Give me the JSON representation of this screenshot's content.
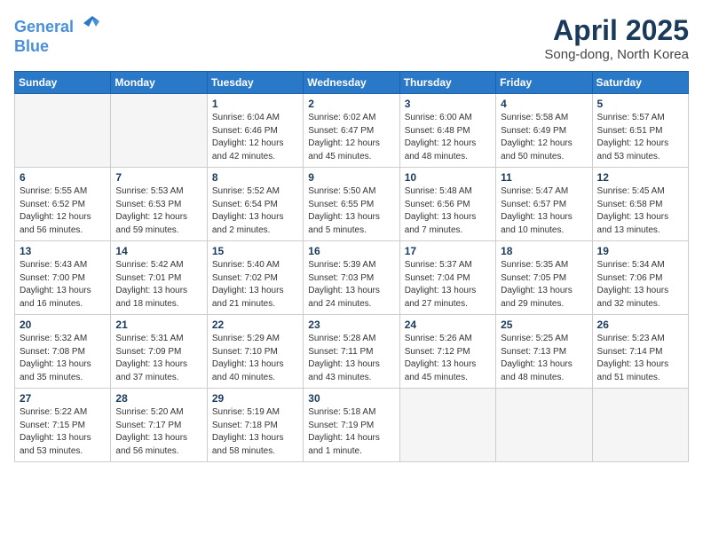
{
  "header": {
    "logo_line1": "General",
    "logo_line2": "Blue",
    "month": "April 2025",
    "location": "Song-dong, North Korea"
  },
  "weekdays": [
    "Sunday",
    "Monday",
    "Tuesday",
    "Wednesday",
    "Thursday",
    "Friday",
    "Saturday"
  ],
  "weeks": [
    [
      {
        "day": "",
        "content": ""
      },
      {
        "day": "",
        "content": ""
      },
      {
        "day": "1",
        "content": "Sunrise: 6:04 AM\nSunset: 6:46 PM\nDaylight: 12 hours and 42 minutes."
      },
      {
        "day": "2",
        "content": "Sunrise: 6:02 AM\nSunset: 6:47 PM\nDaylight: 12 hours and 45 minutes."
      },
      {
        "day": "3",
        "content": "Sunrise: 6:00 AM\nSunset: 6:48 PM\nDaylight: 12 hours and 48 minutes."
      },
      {
        "day": "4",
        "content": "Sunrise: 5:58 AM\nSunset: 6:49 PM\nDaylight: 12 hours and 50 minutes."
      },
      {
        "day": "5",
        "content": "Sunrise: 5:57 AM\nSunset: 6:51 PM\nDaylight: 12 hours and 53 minutes."
      }
    ],
    [
      {
        "day": "6",
        "content": "Sunrise: 5:55 AM\nSunset: 6:52 PM\nDaylight: 12 hours and 56 minutes."
      },
      {
        "day": "7",
        "content": "Sunrise: 5:53 AM\nSunset: 6:53 PM\nDaylight: 12 hours and 59 minutes."
      },
      {
        "day": "8",
        "content": "Sunrise: 5:52 AM\nSunset: 6:54 PM\nDaylight: 13 hours and 2 minutes."
      },
      {
        "day": "9",
        "content": "Sunrise: 5:50 AM\nSunset: 6:55 PM\nDaylight: 13 hours and 5 minutes."
      },
      {
        "day": "10",
        "content": "Sunrise: 5:48 AM\nSunset: 6:56 PM\nDaylight: 13 hours and 7 minutes."
      },
      {
        "day": "11",
        "content": "Sunrise: 5:47 AM\nSunset: 6:57 PM\nDaylight: 13 hours and 10 minutes."
      },
      {
        "day": "12",
        "content": "Sunrise: 5:45 AM\nSunset: 6:58 PM\nDaylight: 13 hours and 13 minutes."
      }
    ],
    [
      {
        "day": "13",
        "content": "Sunrise: 5:43 AM\nSunset: 7:00 PM\nDaylight: 13 hours and 16 minutes."
      },
      {
        "day": "14",
        "content": "Sunrise: 5:42 AM\nSunset: 7:01 PM\nDaylight: 13 hours and 18 minutes."
      },
      {
        "day": "15",
        "content": "Sunrise: 5:40 AM\nSunset: 7:02 PM\nDaylight: 13 hours and 21 minutes."
      },
      {
        "day": "16",
        "content": "Sunrise: 5:39 AM\nSunset: 7:03 PM\nDaylight: 13 hours and 24 minutes."
      },
      {
        "day": "17",
        "content": "Sunrise: 5:37 AM\nSunset: 7:04 PM\nDaylight: 13 hours and 27 minutes."
      },
      {
        "day": "18",
        "content": "Sunrise: 5:35 AM\nSunset: 7:05 PM\nDaylight: 13 hours and 29 minutes."
      },
      {
        "day": "19",
        "content": "Sunrise: 5:34 AM\nSunset: 7:06 PM\nDaylight: 13 hours and 32 minutes."
      }
    ],
    [
      {
        "day": "20",
        "content": "Sunrise: 5:32 AM\nSunset: 7:08 PM\nDaylight: 13 hours and 35 minutes."
      },
      {
        "day": "21",
        "content": "Sunrise: 5:31 AM\nSunset: 7:09 PM\nDaylight: 13 hours and 37 minutes."
      },
      {
        "day": "22",
        "content": "Sunrise: 5:29 AM\nSunset: 7:10 PM\nDaylight: 13 hours and 40 minutes."
      },
      {
        "day": "23",
        "content": "Sunrise: 5:28 AM\nSunset: 7:11 PM\nDaylight: 13 hours and 43 minutes."
      },
      {
        "day": "24",
        "content": "Sunrise: 5:26 AM\nSunset: 7:12 PM\nDaylight: 13 hours and 45 minutes."
      },
      {
        "day": "25",
        "content": "Sunrise: 5:25 AM\nSunset: 7:13 PM\nDaylight: 13 hours and 48 minutes."
      },
      {
        "day": "26",
        "content": "Sunrise: 5:23 AM\nSunset: 7:14 PM\nDaylight: 13 hours and 51 minutes."
      }
    ],
    [
      {
        "day": "27",
        "content": "Sunrise: 5:22 AM\nSunset: 7:15 PM\nDaylight: 13 hours and 53 minutes."
      },
      {
        "day": "28",
        "content": "Sunrise: 5:20 AM\nSunset: 7:17 PM\nDaylight: 13 hours and 56 minutes."
      },
      {
        "day": "29",
        "content": "Sunrise: 5:19 AM\nSunset: 7:18 PM\nDaylight: 13 hours and 58 minutes."
      },
      {
        "day": "30",
        "content": "Sunrise: 5:18 AM\nSunset: 7:19 PM\nDaylight: 14 hours and 1 minute."
      },
      {
        "day": "",
        "content": ""
      },
      {
        "day": "",
        "content": ""
      },
      {
        "day": "",
        "content": ""
      }
    ]
  ]
}
